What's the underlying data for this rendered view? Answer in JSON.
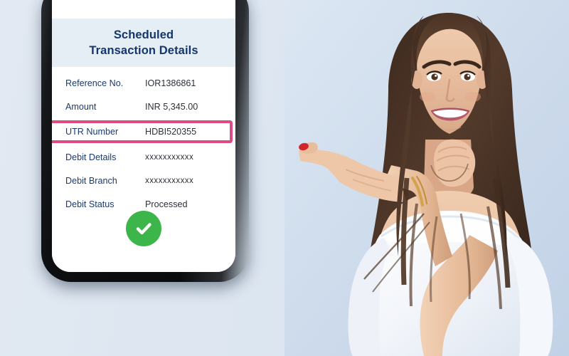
{
  "background": {
    "color": "#dde6f1"
  },
  "phone": {
    "frame_color": "#0a0b0d",
    "screen_color": "#ffffff"
  },
  "app": {
    "header": {
      "band_color": "#e4eef4",
      "title_color": "#14366d",
      "title_line1": "Scheduled",
      "title_line2": "Transaction Details"
    },
    "details": {
      "label_color": "#1b3a6b",
      "value_color": "#2d3138",
      "highlight_color": "#dd4a86",
      "rows": [
        {
          "label": "Reference No.",
          "value": "IOR1386861",
          "highlighted": false
        },
        {
          "label": "Amount",
          "value": "INR 5,345.00",
          "highlighted": false
        },
        {
          "label": "UTR Number",
          "value": "HDBI520355",
          "highlighted": true
        },
        {
          "label": "Debit Details",
          "value": "xxxxxxxxxxx",
          "highlighted": false
        },
        {
          "label": "Debit Branch",
          "value": "xxxxxxxxxxx",
          "highlighted": false
        },
        {
          "label": "Debit Status",
          "value": "Processed",
          "highlighted": false
        }
      ]
    },
    "status": {
      "icon": "check-circle-icon",
      "circle_color": "#3cb54a",
      "check_color": "#ffffff"
    }
  },
  "photo": {
    "description": "smiling woman with long brown hair in white off-shoulder top pointing left with index finger",
    "backdrop_color": "#cfdcec",
    "skin_color": "#e8c0a4",
    "hair_color": "#4a3227",
    "top_color": "#f4f6fa",
    "nail_color": "#d3242c",
    "bracelet_color": "#d2a24d"
  }
}
